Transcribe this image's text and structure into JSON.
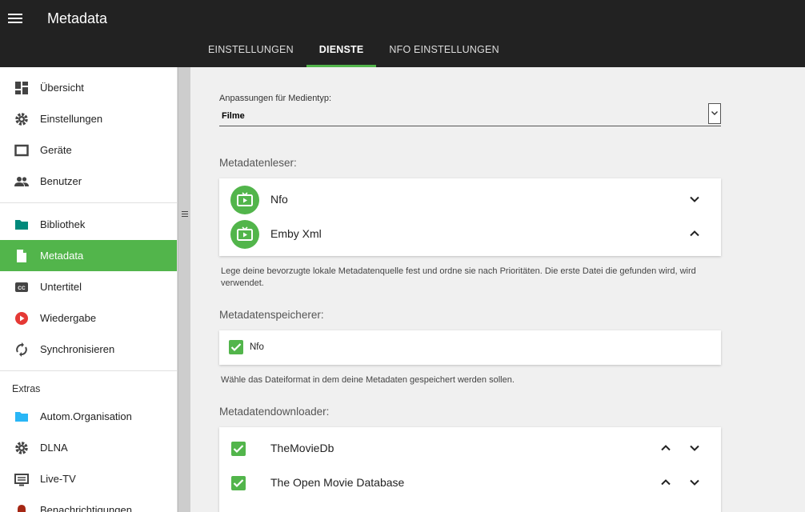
{
  "app": {
    "title": "Metadata"
  },
  "tabs": [
    {
      "label": "EINSTELLUNGEN"
    },
    {
      "label": "DIENSTE"
    },
    {
      "label": "NFO EINSTELLUNGEN"
    }
  ],
  "sidebar": {
    "items": [
      {
        "label": "Übersicht",
        "icon": "dashboard-icon"
      },
      {
        "label": "Einstellungen",
        "icon": "gear-icon"
      },
      {
        "label": "Geräte",
        "icon": "device-icon"
      },
      {
        "label": "Benutzer",
        "icon": "users-icon"
      },
      {
        "label": "Bibliothek",
        "icon": "folder-icon"
      },
      {
        "label": "Metadata",
        "icon": "document-icon"
      },
      {
        "label": "Untertitel",
        "icon": "cc-icon"
      },
      {
        "label": "Wiedergabe",
        "icon": "play-icon"
      },
      {
        "label": "Synchronisieren",
        "icon": "sync-icon"
      }
    ],
    "extras_label": "Extras",
    "extras": [
      {
        "label": "Autom.Organisation",
        "icon": "folder-icon"
      },
      {
        "label": "DLNA",
        "icon": "gear-icon"
      },
      {
        "label": "Live-TV",
        "icon": "tv-icon"
      },
      {
        "label": "Benachrichtigungen",
        "icon": "bell-icon"
      }
    ]
  },
  "main": {
    "media_type_label": "Anpassungen für Medientyp:",
    "media_type_value": "Filme",
    "readers": {
      "title": "Metadatenleser:",
      "items": [
        {
          "label": "Nfo"
        },
        {
          "label": "Emby Xml"
        }
      ],
      "help": "Lege deine bevorzugte lokale Metadatenquelle fest und ordne sie nach Prioritäten. Die erste Datei die gefunden wird, wird verwendet."
    },
    "savers": {
      "title": "Metadatenspeicherer:",
      "items": [
        {
          "label": "Nfo",
          "checked": true
        }
      ],
      "help": "Wähle das Dateiformat in dem deine Metadaten gespeichert werden sollen."
    },
    "downloaders": {
      "title": "Metadatendownloader:",
      "items": [
        {
          "label": "TheMovieDb",
          "checked": true
        },
        {
          "label": "The Open Movie Database",
          "checked": true
        }
      ]
    }
  },
  "colors": {
    "accent": "#52b54b",
    "header": "#222222"
  }
}
